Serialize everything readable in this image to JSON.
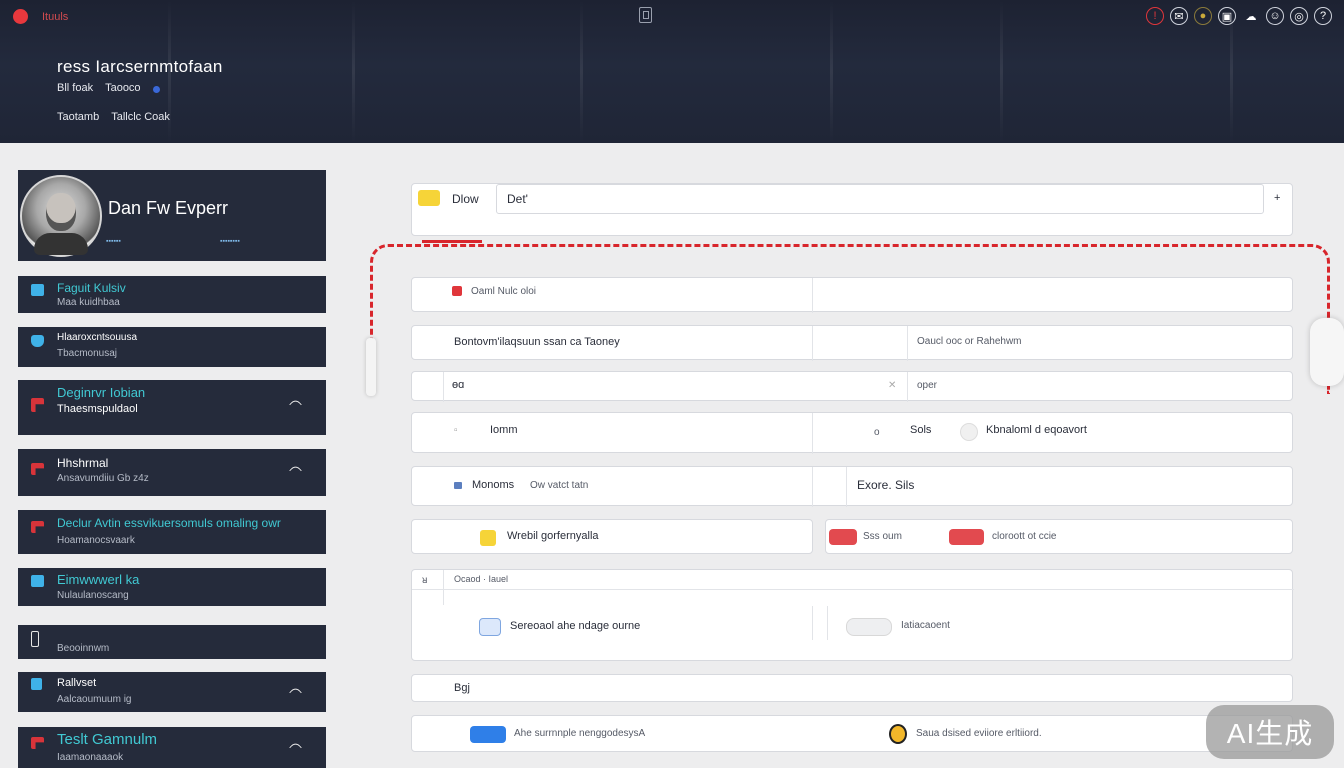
{
  "topbar": {
    "app_name": "Ituuls",
    "tray_icons": [
      "alert-icon",
      "inbox-icon",
      "coin-icon",
      "printer-icon",
      "cloud-icon",
      "user-icon",
      "globe-icon",
      "help-icon"
    ]
  },
  "header": {
    "title": "ress Iarcsernmtofaan",
    "sub_a": "Bll foak",
    "sub_b": "Taooco",
    "link_a": "Taotamb",
    "link_b": "Tallclc Coak"
  },
  "profile": {
    "name": "Dan Fw Evperr",
    "meta_left": "▪▪▪▪▪▪",
    "meta_right": "▪▪▪▪▪▪▪▪"
  },
  "sidebar": {
    "items": [
      {
        "title": "Faguit Kulsiv",
        "sub": "Maa kuidhbaa"
      },
      {
        "title": "Hlaaroxcntsouusa",
        "sub": "Tbacmonusaj"
      },
      {
        "title": "Deginrvr Iobian",
        "sub": "Thaesmspuldaol"
      },
      {
        "title": "Hhshrmal",
        "sub": "Ansavumdiiu Gb z4z"
      },
      {
        "title": "Declur Avtin essvikuersomuls omaling owr",
        "sub": "Hoamanocsvaark"
      },
      {
        "title": "Eimwwwerl ka",
        "sub": "Nulaulanoscang"
      },
      {
        "title": "",
        "sub": "Beooinnwm"
      },
      {
        "title": "Rallvset",
        "sub": "Aalcaoumuum ig"
      },
      {
        "title": "Teslt Gamnulm",
        "sub": "Iaamaonaaaok"
      }
    ]
  },
  "main": {
    "row1": {
      "tab": "Dlow",
      "input_value": "Det'",
      "add": "+"
    },
    "row2": {
      "label": "Oaml Nulc oloi"
    },
    "row3": {
      "left": "Bontovm'ilaqsuun ssan ca Taoney",
      "right": "Oaucl ooc or Rahehwm"
    },
    "row4": {
      "left": "ɵɑ",
      "right": "oper"
    },
    "row5": {
      "left": "Iomm",
      "mid_a": "o",
      "mid_b": "Sols",
      "right": "Kbnaloml d eqoavort"
    },
    "row6": {
      "left_a": "Monoms",
      "left_b": "Ow vatct tatn",
      "right": "Exore. Sils"
    },
    "row7": {
      "left": "Wrebil gorfernyalla",
      "mid": "Sss oum",
      "right": "cloroott ot ccie"
    },
    "row8": {
      "header_icon": "ᴚ",
      "header": "Ocaod · Iauel",
      "left": "Sereoaol ahe ndage ourne",
      "right": "Iatiacaoent"
    },
    "row9": {
      "label": "Bgj"
    },
    "row10": {
      "left": "Ahe surrnnple nenggodesysA",
      "right": "Saua dsised eviiore erltiiord."
    }
  },
  "watermark": "AI生成"
}
